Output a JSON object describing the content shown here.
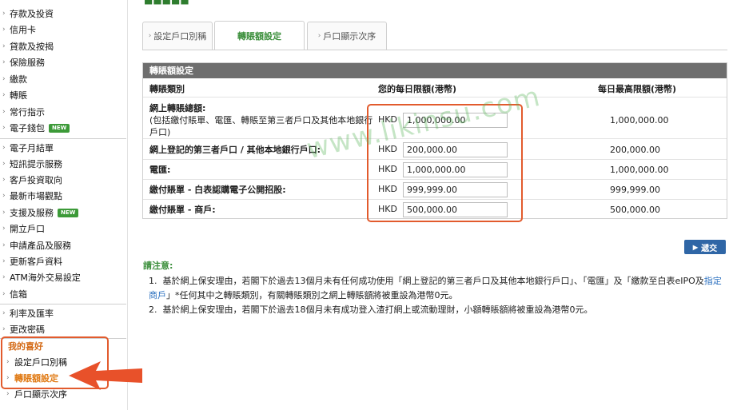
{
  "sidebar": {
    "items": [
      {
        "label": "存款及投資"
      },
      {
        "label": "信用卡"
      },
      {
        "label": "貸款及按揭"
      },
      {
        "label": "保險服務"
      },
      {
        "label": "繳款"
      },
      {
        "label": "轉賬"
      },
      {
        "label": "常行指示"
      },
      {
        "label": "電子錢包",
        "badge": "NEW"
      }
    ],
    "items2": [
      {
        "label": "電子月結單"
      },
      {
        "label": "短訊提示服務"
      },
      {
        "label": "客戶投資取向"
      },
      {
        "label": "最新市場觀點"
      },
      {
        "label": "支援及服務",
        "badge": "NEW"
      },
      {
        "label": "開立戶口"
      },
      {
        "label": "申請產品及服務"
      },
      {
        "label": "更新客戶資料"
      },
      {
        "label": "ATM海外交易設定"
      },
      {
        "label": "信箱"
      }
    ],
    "items3": [
      {
        "label": "利率及匯率"
      },
      {
        "label": "更改密碼"
      }
    ],
    "favorites_title": "我的喜好",
    "favorites": [
      {
        "label": "設定戶口別稱"
      },
      {
        "label": "轉賬額設定",
        "active": true
      },
      {
        "label": "戶口顯示次序"
      }
    ]
  },
  "tabs": [
    {
      "label": "設定戶口別稱"
    },
    {
      "label": "轉賬額設定",
      "active": true
    },
    {
      "label": "戶口顯示次序"
    }
  ],
  "panel": {
    "title": "轉賬額設定",
    "col_type": "轉賬類別",
    "col_daily": "您的每日限額(港幣)",
    "col_max": "每日最高限額(港幣)",
    "rows": [
      {
        "label": "網上轉賬總額:",
        "note": "(包括繳付賬單、電匯、轉賬至第三者戶口及其他本地銀行戶口)",
        "currency": "HKD",
        "value": "1,000,000.00",
        "max": "1,000,000.00"
      },
      {
        "label": "網上登記的第三者戶口 / 其他本地銀行戶口:",
        "currency": "HKD",
        "value": "200,000.00",
        "max": "200,000.00"
      },
      {
        "label": "電匯:",
        "currency": "HKD",
        "value": "1,000,000.00",
        "max": "1,000,000.00"
      },
      {
        "label": "繳付賬單 - 白表認購電子公開招股:",
        "currency": "HKD",
        "value": "999,999.00",
        "max": "999,999.00"
      },
      {
        "label": "繳付賬單 - 商戶:",
        "currency": "HKD",
        "value": "500,000.00",
        "max": "500,000.00"
      }
    ]
  },
  "submit_label": "遞交",
  "notes": {
    "title": "請注意:",
    "items": [
      {
        "num": "1.",
        "text": "基於網上保安理由，若閣下於過去13個月未有任何成功使用「網上登記的第三者戶口及其他本地銀行戶口」、「電匯」及「繳款至白表eIPO及",
        "link": "指定商戶",
        "text2": "」*任何其中之轉賬類別，有關轉賬類別之網上轉賬額將被重設為港幣0元。"
      },
      {
        "num": "2.",
        "text": "基於網上保安理由，若閣下於過去18個月未有成功登入渣打網上或流動理財，小額轉賬額將被重設為港幣0元。"
      }
    ]
  },
  "watermark": "www.likinsu.com",
  "colors": {
    "accent_green": "#3c8f3c",
    "highlight_orange": "#e25b2d",
    "header_gray": "#6e6e6e",
    "button_blue": "#2f66a6"
  }
}
